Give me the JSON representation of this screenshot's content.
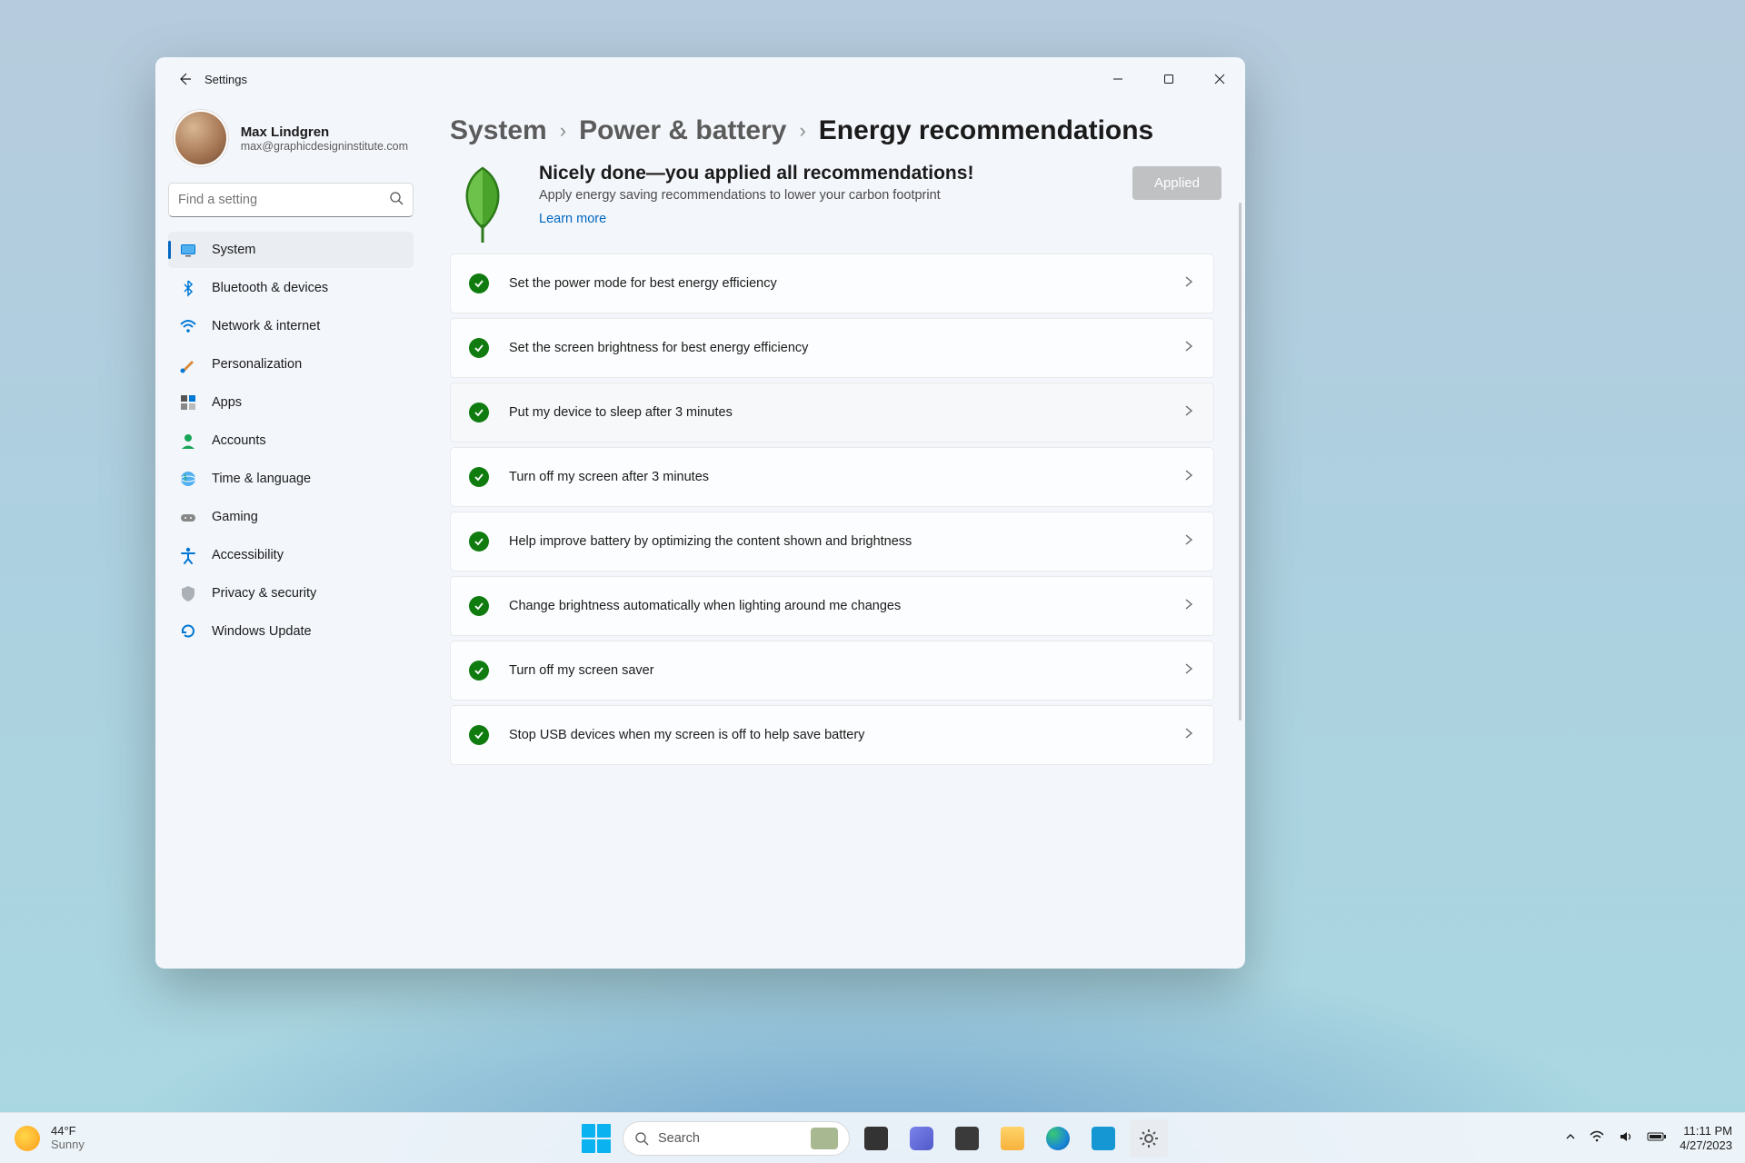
{
  "window": {
    "title": "Settings"
  },
  "profile": {
    "name": "Max Lindgren",
    "email": "max@graphicdesigninstitute.com"
  },
  "search": {
    "placeholder": "Find a setting"
  },
  "sidebar": {
    "items": [
      {
        "label": "System"
      },
      {
        "label": "Bluetooth & devices"
      },
      {
        "label": "Network & internet"
      },
      {
        "label": "Personalization"
      },
      {
        "label": "Apps"
      },
      {
        "label": "Accounts"
      },
      {
        "label": "Time & language"
      },
      {
        "label": "Gaming"
      },
      {
        "label": "Accessibility"
      },
      {
        "label": "Privacy & security"
      },
      {
        "label": "Windows Update"
      }
    ]
  },
  "breadcrumb": {
    "a": "System",
    "b": "Power & battery",
    "c": "Energy recommendations"
  },
  "hero": {
    "title": "Nicely done—you applied all recommendations!",
    "subtitle": "Apply energy saving recommendations to lower your carbon footprint",
    "link": "Learn more",
    "button": "Applied"
  },
  "recommendations": [
    {
      "label": "Set the power mode for best energy efficiency"
    },
    {
      "label": "Set the screen brightness for best energy efficiency"
    },
    {
      "label": "Put my device to sleep after 3 minutes"
    },
    {
      "label": "Turn off my screen after 3 minutes"
    },
    {
      "label": "Help improve battery by optimizing the content shown and brightness"
    },
    {
      "label": "Change brightness automatically when lighting around me changes"
    },
    {
      "label": "Turn off my screen saver"
    },
    {
      "label": "Stop USB devices when my screen is off to help save battery"
    }
  ],
  "taskbar": {
    "weather_temp": "44°F",
    "weather_desc": "Sunny",
    "search_label": "Search",
    "time": "11:11 PM",
    "date": "4/27/2023"
  },
  "colors": {
    "accent": "#0067c0",
    "success": "#107c10"
  }
}
